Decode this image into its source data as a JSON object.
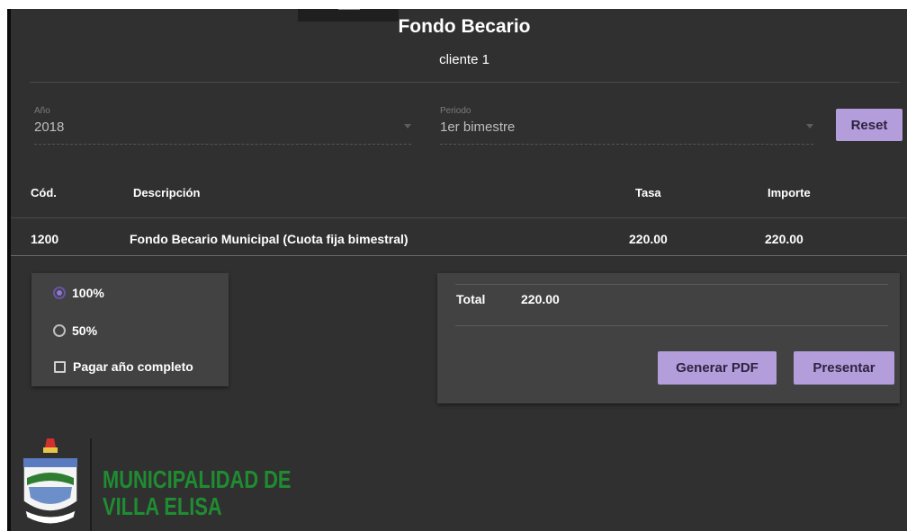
{
  "header": {
    "title": "Fondo Becario",
    "subtitle": "cliente 1"
  },
  "filters": {
    "year": {
      "label": "Año",
      "value": "2018"
    },
    "period": {
      "label": "Periodo",
      "value": "1er bimestre"
    },
    "reset_label": "Reset"
  },
  "table": {
    "headers": {
      "code": "Cód.",
      "description": "Descripción",
      "rate": "Tasa",
      "amount": "Importe"
    },
    "rows": [
      {
        "code": "1200",
        "description": "Fondo Becario Municipal (Cuota fija bimestral)",
        "rate": "220.00",
        "amount": "220.00"
      }
    ]
  },
  "options": {
    "radio_full": "100%",
    "radio_half": "50%",
    "selected": "100%",
    "pay_full_year": "Pagar año completo",
    "pay_full_year_checked": false
  },
  "summary": {
    "total_label": "Total",
    "total_value": "220.00",
    "pdf_label": "Generar PDF",
    "submit_label": "Presentar"
  },
  "brand": {
    "line1": "MUNICIPALIDAD DE",
    "line2": "VILLA ELISA",
    "color": "#1f8c31",
    "accent": "#b39ddb"
  }
}
